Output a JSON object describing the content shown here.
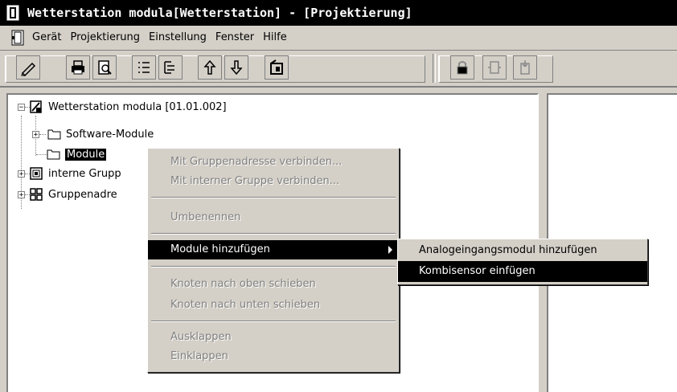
{
  "window": {
    "title": "Wetterstation modula[Wetterstation] - [Projektierung]"
  },
  "menubar": {
    "items": [
      "Gerät",
      "Projektierung",
      "Einstellung",
      "Fenster",
      "Hilfe"
    ]
  },
  "toolbar": {
    "icons": [
      "edit-icon",
      "print-icon",
      "print-preview-icon",
      "list-icon",
      "tree-list-icon",
      "move-up-icon",
      "move-down-icon",
      "device-icon",
      "lock-icon",
      "module-icon",
      "module-add-icon"
    ]
  },
  "tree": {
    "root": "Wetterstation modula [01.01.002]",
    "software_modules": "Software-Module",
    "modules": "Module",
    "internal_groups": "interne Grupp",
    "group_addresses": "Gruppenadre"
  },
  "context_menu": {
    "items": [
      {
        "label": "Mit Gruppenadresse verbinden...",
        "enabled": false
      },
      {
        "label": "Mit interner Gruppe verbinden...",
        "enabled": false
      },
      {
        "label": "Umbenennen",
        "enabled": false
      },
      {
        "label": "Module hinzufügen",
        "enabled": true,
        "highlighted": true
      },
      {
        "label": "Knoten nach oben schieben",
        "enabled": false
      },
      {
        "label": "Knoten nach unten schieben",
        "enabled": false
      },
      {
        "label": "Ausklappen",
        "enabled": false
      },
      {
        "label": "Einklappen",
        "enabled": false
      }
    ]
  },
  "submenu": {
    "items": [
      {
        "label": "Analogeingangsmodul hinzufügen",
        "highlighted": false
      },
      {
        "label": "Kombisensor einfügen",
        "highlighted": true
      }
    ]
  }
}
